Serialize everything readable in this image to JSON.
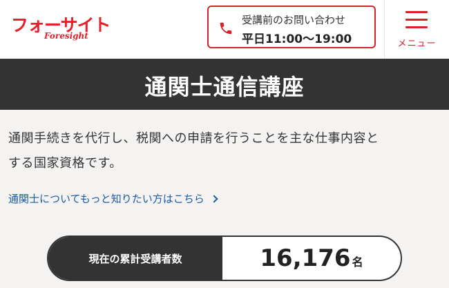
{
  "header": {
    "logo_text": "フォーサイト",
    "logo_sub": "Foresight",
    "contact": {
      "label": "受講前のお問い合わせ",
      "hours": "平日11:00〜19:00"
    },
    "menu_label": "メニュー"
  },
  "title": "通関士通信講座",
  "description": {
    "lines": [
      "通関手続きを代行し、税関への申請を行うことを主な仕事内容と",
      "する国家資格です。"
    ]
  },
  "link": {
    "text": "通関士についてもっと知りたい方はこちら"
  },
  "counter": {
    "label": "現在の累計受講者数",
    "value": "16,176",
    "unit": "名"
  },
  "colors": {
    "brand_red": "#d7222a",
    "dark": "#333333",
    "link_blue": "#1a5aa6",
    "background": "#f4f3f1"
  },
  "icons": {
    "phone": "phone-icon",
    "menu": "hamburger-menu-icon",
    "link": "chevron-right-icon"
  }
}
